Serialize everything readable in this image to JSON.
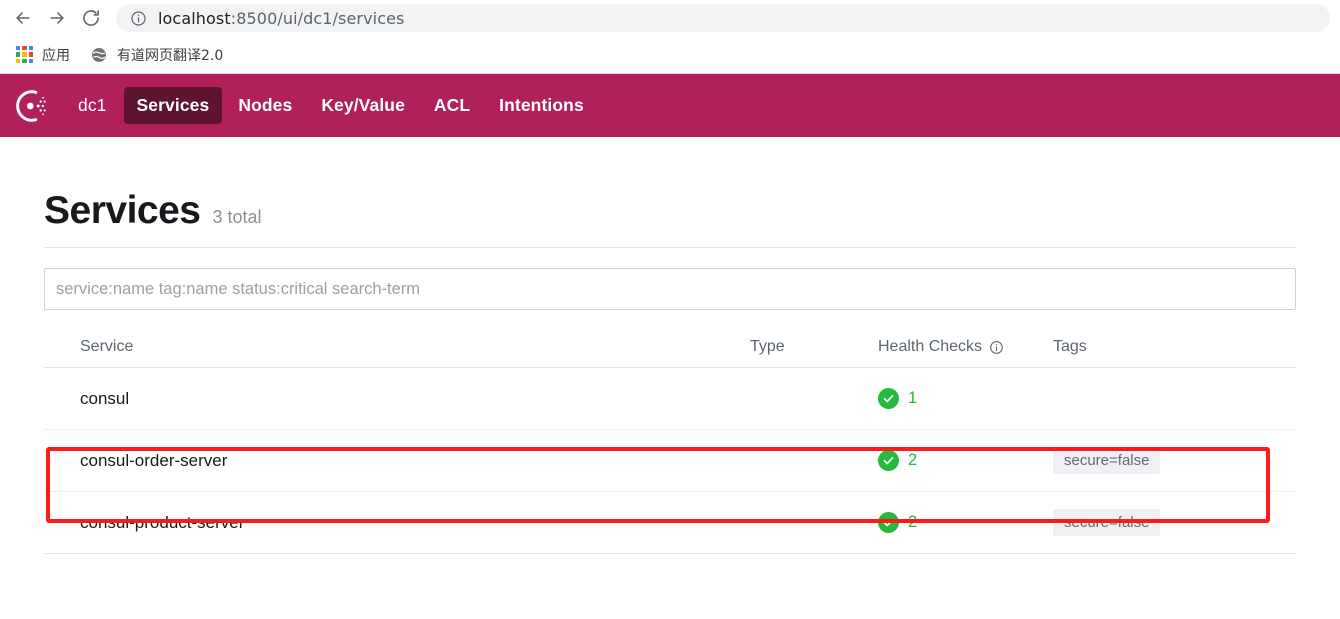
{
  "browser": {
    "back_icon": "back-arrow-icon",
    "forward_icon": "forward-arrow-icon",
    "reload_icon": "reload-icon",
    "site_info_icon": "site-info-icon",
    "url_host": "localhost",
    "url_path": ":8500/ui/dc1/services",
    "url_full": "localhost:8500/ui/dc1/services",
    "bookmarks": [
      {
        "icon": "apps-grid-icon",
        "label": "应用"
      },
      {
        "icon": "globe-icon",
        "label": "有道网页翻译2.0"
      }
    ]
  },
  "app_nav": {
    "logo_icon": "consul-logo-icon",
    "datacenter": "dc1",
    "items": [
      {
        "label": "Services",
        "active": true
      },
      {
        "label": "Nodes",
        "active": false
      },
      {
        "label": "Key/Value",
        "active": false
      },
      {
        "label": "ACL",
        "active": false
      },
      {
        "label": "Intentions",
        "active": false
      }
    ]
  },
  "page": {
    "title": "Services",
    "total": "3 total"
  },
  "search": {
    "value": "",
    "placeholder": "service:name tag:name status:critical search-term"
  },
  "table": {
    "columns": {
      "service": "Service",
      "type": "Type",
      "health": "Health Checks",
      "health_info_icon": "info-icon",
      "tags": "Tags"
    },
    "rows": [
      {
        "service": "consul",
        "type": "",
        "health_status_icon": "check-circle-icon",
        "health_count": "1",
        "tags": []
      },
      {
        "service": "consul-order-server",
        "type": "",
        "health_status_icon": "check-circle-icon",
        "health_count": "2",
        "tags": [
          "secure=false"
        ],
        "highlighted": true
      },
      {
        "service": "consul-product-server",
        "type": "",
        "health_status_icon": "check-circle-icon",
        "health_count": "2",
        "tags": [
          "secure=false"
        ]
      }
    ]
  },
  "colors": {
    "brand": "#b0205a",
    "brand_active": "#5e1430",
    "health_green": "#25ba3d",
    "annotation_red": "#fc1c15",
    "tag_bg": "#eef0f3"
  },
  "annotation": {
    "type": "rectangle-highlight",
    "target_row": "consul-order-server"
  }
}
